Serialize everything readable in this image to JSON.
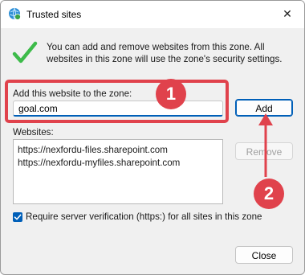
{
  "window": {
    "title": "Trusted sites",
    "close_glyph": "✕"
  },
  "info": {
    "text": "You can add and remove websites from this zone. All websites in this zone will use the zone's security settings."
  },
  "add_site": {
    "label": "Add this website to the zone:",
    "value": "goal.com",
    "button": "Add"
  },
  "websites": {
    "label": "Websites:",
    "items": [
      "https://nexfordu-files.sharepoint.com",
      "https://nexfordu-myfiles.sharepoint.com"
    ],
    "remove_button": "Remove"
  },
  "verification": {
    "checked": true,
    "label": "Require server verification (https:) for all sites in this zone"
  },
  "footer": {
    "close_button": "Close"
  },
  "annotations": {
    "step1": "1",
    "step2": "2",
    "color": "#e0424c"
  },
  "icons": [
    "trusted-sites-icon",
    "checkmark-icon",
    "close-icon",
    "checkbox-check-icon"
  ]
}
